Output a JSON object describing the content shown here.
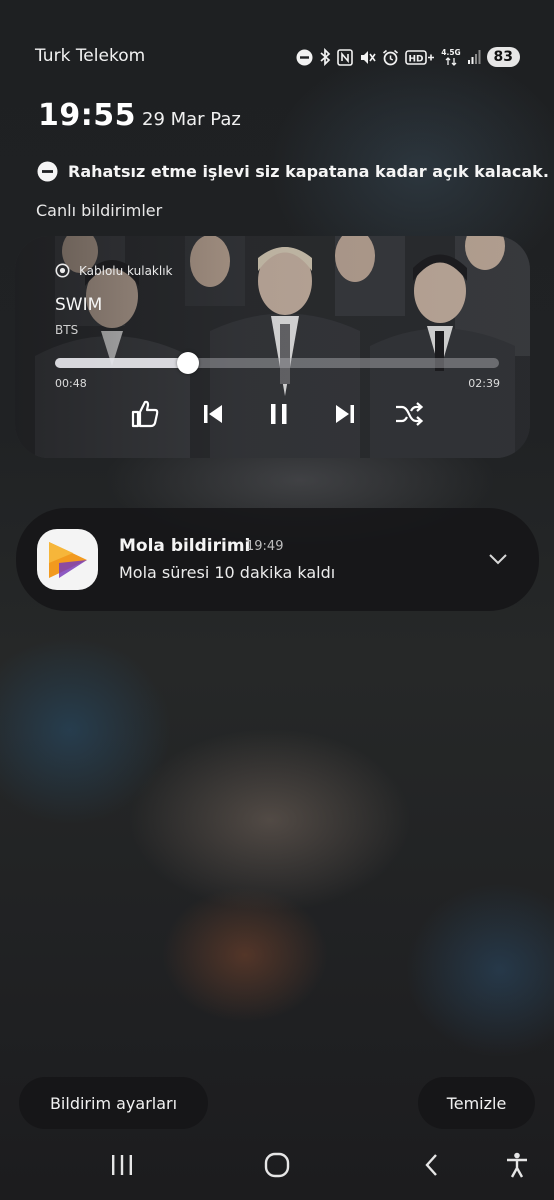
{
  "status_bar": {
    "carrier": "Turk Telekom",
    "network": "4.5G",
    "battery": "83",
    "icons": [
      "dnd-icon",
      "bluetooth-icon",
      "nfc-icon",
      "mute-icon",
      "alarm-icon",
      "wifi-calling-icon",
      "hd-voice-icon",
      "data-arrows-icon",
      "signal-icon",
      "battery-icon"
    ]
  },
  "clock": {
    "time": "19:55",
    "date": "29 Mar Paz"
  },
  "dnd_banner": {
    "text": "Rahatsız etme işlevi siz kapatana kadar açık kalacak."
  },
  "live_notifications": {
    "title": "Canlı bildirimler"
  },
  "media": {
    "output": "Kablolu kulaklık",
    "title": "SWIM",
    "artist": "BTS",
    "elapsed": "00:48",
    "total": "02:39",
    "progress": 0.3,
    "controls": [
      "thumbs-up-icon",
      "previous-icon",
      "pause-icon",
      "next-icon",
      "shuffle-icon"
    ]
  },
  "notification": {
    "app_title": "Mola bildirimi",
    "time": "19:49",
    "body": "Mola süresi 10 dakika kaldı",
    "app_icon": "play-triangle-icon"
  },
  "buttons": {
    "settings": "Bildirim ayarları",
    "clear": "Temizle"
  },
  "nav": [
    "recents-icon",
    "home-icon",
    "back-icon",
    "accessibility-icon"
  ],
  "colors": {
    "card_background": "#161618",
    "app_icon_orange": "#f29a1f",
    "app_icon_purple": "#7a3db8"
  }
}
